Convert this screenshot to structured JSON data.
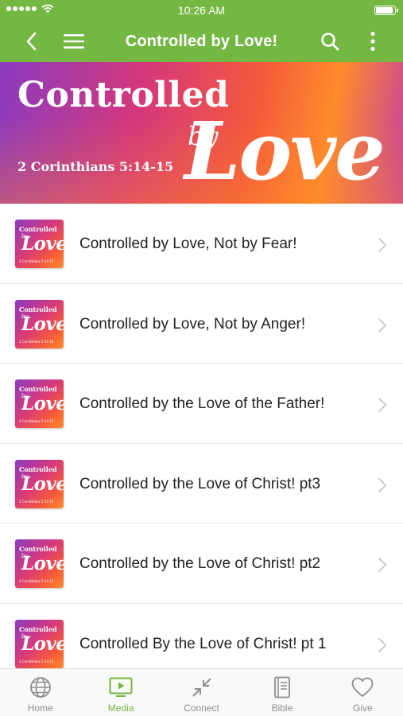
{
  "status_bar": {
    "time": "10:26 AM"
  },
  "nav": {
    "title": "Controlled by Love!"
  },
  "banner": {
    "title": "Controlled",
    "by": "by",
    "love": "Love",
    "verse": "2 Corinthians 5:14-15"
  },
  "thumbnail": {
    "title": "Controlled",
    "by": "by",
    "love": "Love",
    "verse": "2 Corinthians 5:14-15"
  },
  "sermons": [
    {
      "label": "Controlled by Love, Not by Fear!"
    },
    {
      "label": "Controlled by Love, Not by Anger!"
    },
    {
      "label": "Controlled by the Love of the Father!"
    },
    {
      "label": "Controlled by the Love of Christ! pt3"
    },
    {
      "label": "Controlled by the Love of Christ! pt2"
    },
    {
      "label": "Controlled By the Love of Christ! pt 1"
    }
  ],
  "tabs": [
    {
      "label": "Home",
      "icon": "globe-icon"
    },
    {
      "label": "Media",
      "icon": "media-play-icon",
      "active": true
    },
    {
      "label": "Connect",
      "icon": "collapse-arrows-icon"
    },
    {
      "label": "Bible",
      "icon": "bible-book-icon"
    },
    {
      "label": "Give",
      "icon": "heart-icon"
    }
  ],
  "colors": {
    "accent": "#74b743",
    "tab_inactive": "#8e8e8e"
  }
}
